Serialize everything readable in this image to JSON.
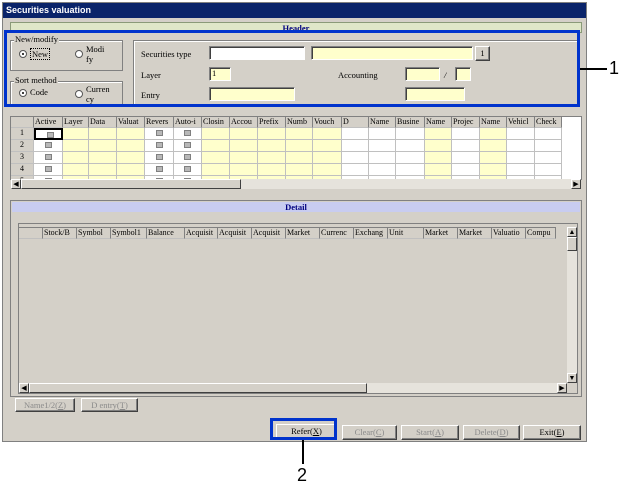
{
  "window": {
    "title": "Securities valuation"
  },
  "header": {
    "title": "Header",
    "new_modify": {
      "group_label": "New/modify",
      "new_label": "New",
      "modify_label_1": "Modi",
      "modify_label_2": "fy"
    },
    "sort_method": {
      "group_label": "Sort method",
      "code_label": "Code",
      "currency_label_1": "Curren",
      "currency_label_2": "cy"
    },
    "securities_type_label": "Securities type",
    "securities_type_value": "",
    "securities_type_name": "",
    "lookup_button": "1",
    "layer_label": "Layer",
    "layer_value": "1",
    "accounting_label": "Accounting",
    "accounting_sep": "/",
    "entry_label": "Entry"
  },
  "upper_grid": {
    "columns": [
      "Active",
      "Layer",
      "Data",
      "Valuat",
      "Revers",
      "Auto-i",
      "Closin",
      "Accou",
      "Prefix",
      "Numb",
      "Vouch",
      "D",
      "Name",
      "Busine",
      "Name",
      "Projec",
      "Name",
      "Vehicl",
      "Check"
    ],
    "rows": [
      "1",
      "2",
      "3",
      "4",
      "5"
    ]
  },
  "detail": {
    "title": "Detail",
    "columns": [
      "Stock/B",
      "Symbol",
      "Symbol1",
      "Balance",
      "Acquisit",
      "Acquisit",
      "Acquisit",
      "Market",
      "Currenc",
      "Exchang",
      "Unit",
      "Market",
      "Market",
      "Valuatio",
      "Compu"
    ],
    "name12_button": "Name1/2(",
    "name12_key": "Z",
    "name12_close": ")",
    "dentry_button": "D entry(",
    "dentry_key": "T",
    "dentry_close": ")"
  },
  "footer": {
    "refer": {
      "text": "Refer(",
      "key": "X",
      "close": ")"
    },
    "clear": {
      "text": "Clear(",
      "key": "C",
      "close": ")"
    },
    "start": {
      "text": "Start(",
      "key": "A",
      "close": ")"
    },
    "delete": {
      "text": "Delete(",
      "key": "D",
      "close": ")"
    },
    "exit": {
      "text": "Exit(",
      "key": "E",
      "close": ")"
    }
  },
  "annotations": {
    "callout_1": "1",
    "callout_2": "2"
  },
  "colors": {
    "title_bar": "#0a246a",
    "annotation": "#0033cc",
    "input_yellow": "#ffffcc",
    "window_bg": "#d4d0c8"
  }
}
